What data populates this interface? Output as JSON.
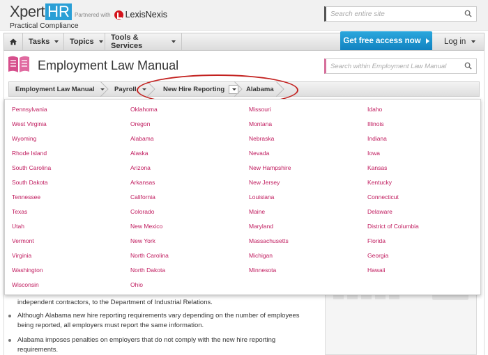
{
  "brand": {
    "logo_main": "Xpert",
    "logo_accent": "HR",
    "logo_sub": "Practical Compliance",
    "partner_text": "Partnered with",
    "partner_name": "LexisNexis"
  },
  "top_search": {
    "placeholder": "Search entire site"
  },
  "nav": {
    "items": [
      {
        "label": "Tasks"
      },
      {
        "label": "Topics"
      },
      {
        "label": "Tools & Services"
      }
    ],
    "cta_label": "Get free access now",
    "login_label": "Log in"
  },
  "manual": {
    "title": "Employment Law Manual",
    "search_placeholder": "Search within Employment Law Manual"
  },
  "breadcrumbs": [
    {
      "label": "Employment Law Manual"
    },
    {
      "label": "Payroll"
    },
    {
      "label": "New Hire Reporting"
    },
    {
      "label": "Alabama"
    }
  ],
  "states": {
    "columns": [
      [
        "Pennsylvania",
        "West Virginia",
        "Wyoming",
        "Rhode Island",
        "South Carolina",
        "South Dakota",
        "Tennessee",
        "Texas",
        "Utah",
        "Vermont",
        "Virginia",
        "Washington",
        "Wisconsin"
      ],
      [
        "Oklahoma",
        "Oregon",
        "Alabama",
        "Alaska",
        "Arizona",
        "Arkansas",
        "California",
        "Colorado",
        "New Mexico",
        "New York",
        "North Carolina",
        "North Dakota",
        "Ohio"
      ],
      [
        "Missouri",
        "Montana",
        "Nebraska",
        "Nevada",
        "New Hampshire",
        "New Jersey",
        "Louisiana",
        "Maine",
        "Maryland",
        "Massachusetts",
        "Michigan",
        "Minnesota"
      ],
      [
        "Idaho",
        "Illinois",
        "Indiana",
        "Iowa",
        "Kansas",
        "Kentucky",
        "Connecticut",
        "Delaware",
        "District of Columbia",
        "Florida",
        "Georgia",
        "Hawaii"
      ]
    ]
  },
  "content": {
    "line1": "independent contractors, to the Department of Industrial Relations.",
    "bullet2_line1": "Although Alabama new hire reporting requirements vary depending on the number of employees",
    "bullet2_line2": "being reported, all employers must report the same information.",
    "bullet3_line1": "Alabama imposes penalties on employers that do not comply with the new hire reporting",
    "bullet3_line2": "requirements."
  },
  "colors": {
    "accent_blue": "#2a9fd6",
    "link_magenta": "#c01b5e",
    "highlight_red": "#c3211f"
  }
}
